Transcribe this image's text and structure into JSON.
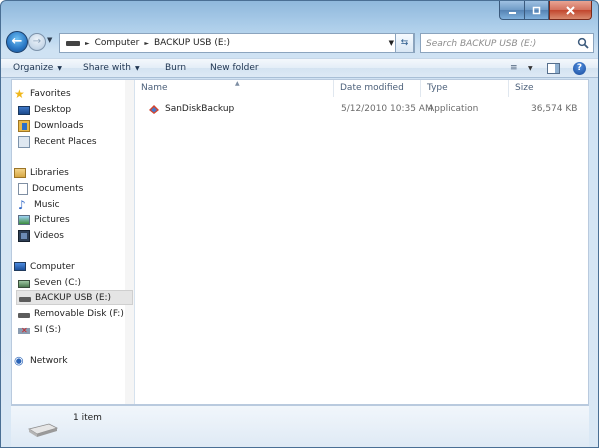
{
  "address": {
    "crumbs": [
      "Computer",
      "BACKUP USB (E:)"
    ]
  },
  "search": {
    "placeholder": "Search BACKUP USB (E:)"
  },
  "toolbar": {
    "organize": "Organize",
    "share_with": "Share with",
    "burn": "Burn",
    "new_folder": "New folder"
  },
  "nav": {
    "favorites": {
      "label": "Favorites",
      "icon": "star-icon"
    },
    "favorite_items": [
      {
        "label": "Desktop",
        "icon": "desktop-icon"
      },
      {
        "label": "Downloads",
        "icon": "downloads-icon"
      },
      {
        "label": "Recent Places",
        "icon": "recent-places-icon"
      }
    ],
    "libraries": {
      "label": "Libraries",
      "icon": "libraries-icon"
    },
    "library_items": [
      {
        "label": "Documents",
        "icon": "document-icon"
      },
      {
        "label": "Music",
        "icon": "music-icon"
      },
      {
        "label": "Pictures",
        "icon": "pictures-icon"
      },
      {
        "label": "Videos",
        "icon": "videos-icon"
      }
    ],
    "computer": {
      "label": "Computer",
      "icon": "computer-icon"
    },
    "computer_items": [
      {
        "label": "Seven (C:)",
        "icon": "drive-icon"
      },
      {
        "label": "BACKUP USB (E:)",
        "icon": "usb-drive-icon",
        "selected": true
      },
      {
        "label": "Removable Disk (F:)",
        "icon": "usb-drive-icon"
      },
      {
        "label": "SI (S:)",
        "icon": "disconnected-drive-icon"
      }
    ],
    "network": {
      "label": "Network",
      "icon": "network-icon"
    }
  },
  "columns": {
    "name": "Name",
    "date_modified": "Date modified",
    "type": "Type",
    "size": "Size"
  },
  "files": [
    {
      "name": "SanDiskBackup",
      "date_modified": "5/12/2010 10:35 AM",
      "type": "Application",
      "size": "36,574 KB",
      "icon": "application-icon"
    }
  ],
  "details": {
    "item_count": "1 item"
  },
  "colors": {
    "window_frame": "#b9d6ee",
    "close_button": "#c2462d",
    "selection": "#e5e5e5"
  }
}
